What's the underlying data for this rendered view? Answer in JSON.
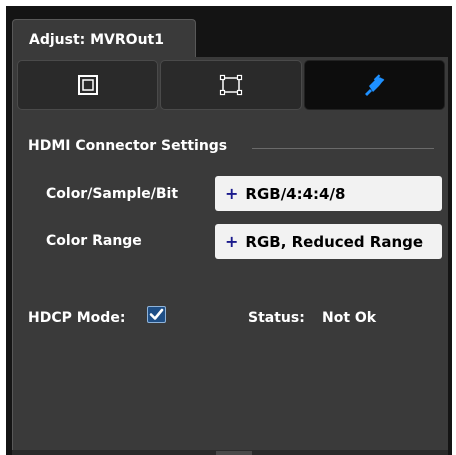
{
  "window": {
    "tab_title": "Adjust: MVROut1"
  },
  "mode_tabs": [
    {
      "icon": "frame-square-icon",
      "active": false
    },
    {
      "icon": "crop-corners-icon",
      "active": false
    },
    {
      "icon": "connector-plug-icon",
      "active": true
    }
  ],
  "section": {
    "title": "HDMI Connector Settings"
  },
  "color_sample_bit": {
    "label": "Color/Sample/Bit",
    "plus": "+",
    "value": "RGB/4:4:4/8"
  },
  "color_range": {
    "label": "Color Range",
    "plus": "+",
    "value": "RGB, Reduced Range"
  },
  "hdcp": {
    "label": "HDCP Mode:",
    "checked": true
  },
  "status": {
    "label": "Status:",
    "value": "Not Ok"
  },
  "colors": {
    "accent_blue": "#1e90ff",
    "panel_bg": "#3a3a3a"
  }
}
